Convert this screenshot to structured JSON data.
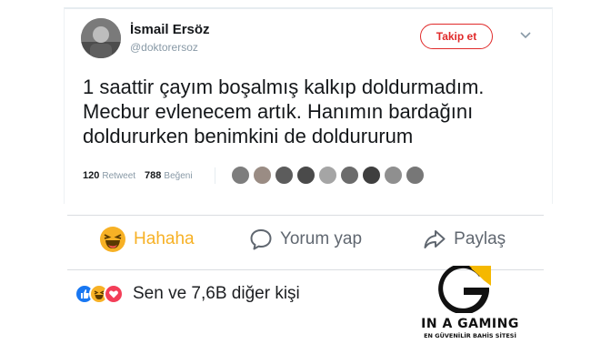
{
  "tweet": {
    "display_name": "İsmail Ersöz",
    "handle": "@doktorersoz",
    "follow_label": "Takip et",
    "caret_icon": "chevron-down-icon",
    "text_lines": [
      "1 saattir çayım boşalmış kalkıp doldurmadım.",
      "Mecbur evlenecem artık. Hanımın bardağını",
      "doldururken benimkini de doldururum"
    ],
    "retweets": {
      "count": "120",
      "label": "Retweet"
    },
    "likes": {
      "count": "788",
      "label": "Beğeni"
    },
    "liker_avatar_count": 9
  },
  "facebook": {
    "actions": [
      {
        "label": "Hahaha",
        "icon": "haha-emoji-icon",
        "active": true
      },
      {
        "label": "Yorum yap",
        "icon": "comment-bubble-icon",
        "active": false
      },
      {
        "label": "Paylaş",
        "icon": "share-arrow-icon",
        "active": false
      }
    ],
    "reactions_text": "Sen ve 7,6B diğer kişi",
    "reaction_icons": [
      "like-icon",
      "haha-icon",
      "love-icon"
    ],
    "colors": {
      "haha_active": "#f7b125",
      "like": "#1877f2",
      "love": "#f33e58",
      "muted": "#606770"
    }
  },
  "watermark": {
    "name": "IN A GAMING",
    "tagline": "EN GÜVENİLİR BAHİS SİTESİ",
    "colors": {
      "black": "#111111",
      "yellow": "#f5b800"
    }
  },
  "colors": {
    "follow_red": "#e02a2a",
    "twitter_gray": "#8899a6",
    "text": "#14171a"
  }
}
